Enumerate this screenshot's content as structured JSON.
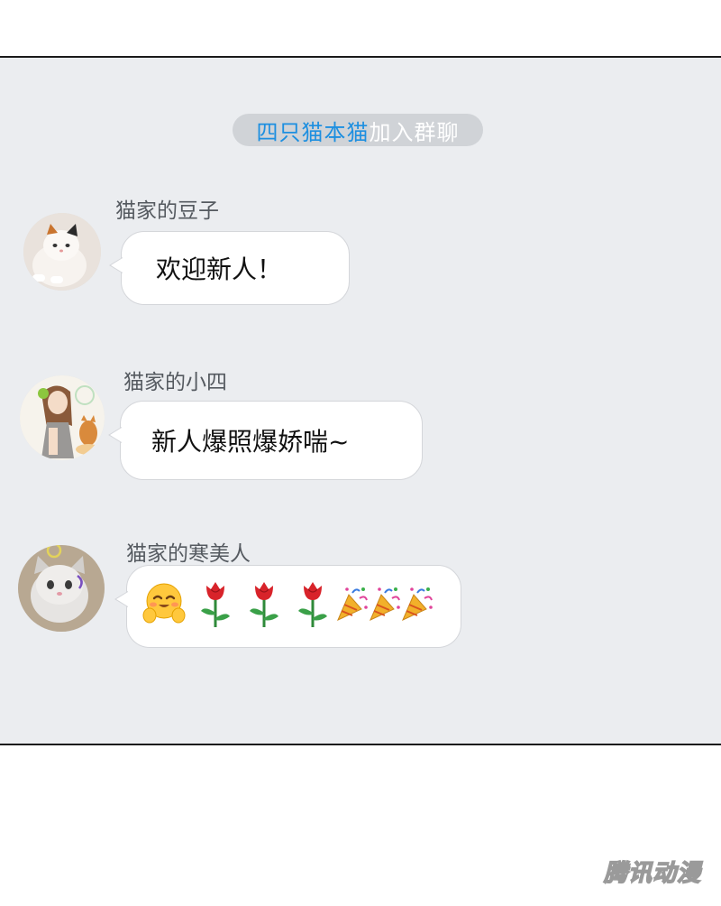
{
  "system_notice": {
    "member": "四只猫本猫",
    "action": "加入群聊"
  },
  "messages": [
    {
      "sender": "猫家的豆子",
      "text": "欢迎新人！",
      "avatar_icon": "kitten-avatar-icon"
    },
    {
      "sender": "猫家的小四",
      "text": "新人爆照爆娇喘~",
      "avatar_icon": "girl-with-cat-avatar-icon"
    },
    {
      "sender": "猫家的寒美人",
      "text": "",
      "avatar_icon": "gray-kitten-avatar-icon",
      "emojis": [
        "blush-face-emoji",
        "rose-emoji",
        "rose-emoji",
        "rose-emoji",
        "party-popper-emoji",
        "party-popper-emoji",
        "party-popper-emoji"
      ]
    }
  ],
  "watermark": "腾讯动漫",
  "colors": {
    "panel_bg": "#ebedf0",
    "notice_bg": "#d0d3d7",
    "member_link": "#1d8fe0",
    "bubble_bg": "#ffffff"
  }
}
